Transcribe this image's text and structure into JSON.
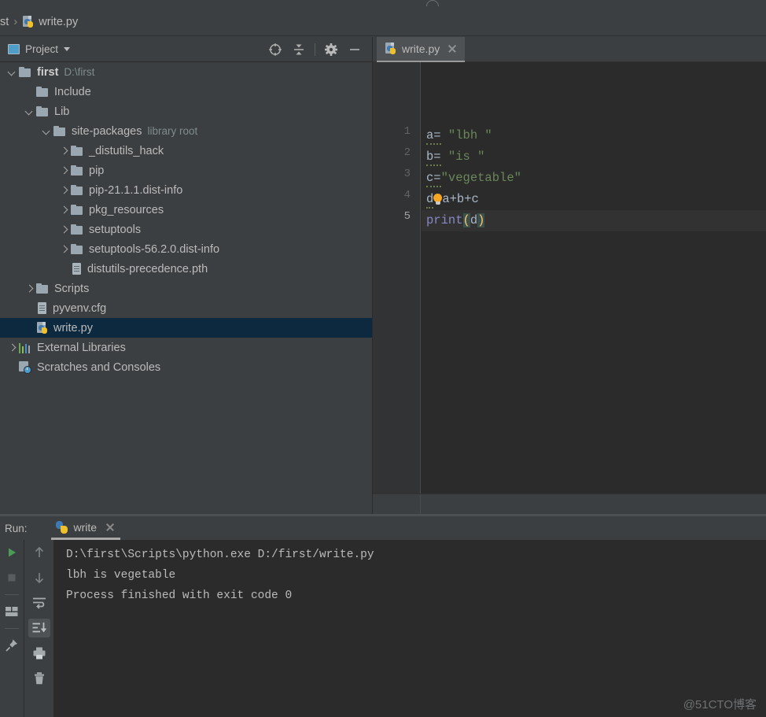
{
  "breadcrumb": {
    "truncated_root": "st",
    "separator": "›",
    "file": "write.py",
    "file_icon": "python-file-icon"
  },
  "project_panel": {
    "title": "Project",
    "title_icon": "project-window-icon",
    "dropdown_icon": "chevron-down-icon",
    "toolbar": [
      {
        "name": "select-opened-file-icon",
        "glyph": "crosshair-target"
      },
      {
        "name": "collapse-all-icon",
        "glyph": "collapse-arrows"
      },
      {
        "name": "settings-gear-icon",
        "glyph": "gear"
      },
      {
        "name": "hide-panel-icon",
        "glyph": "minus"
      }
    ],
    "tree": [
      {
        "label": "first",
        "detail": "D:\\first",
        "icon": "folder-icon",
        "arrow": "down",
        "indent": 0,
        "bold": true,
        "selected": false
      },
      {
        "label": "Include",
        "detail": "",
        "icon": "folder-icon",
        "arrow": "none",
        "indent": 1,
        "bold": false,
        "selected": false
      },
      {
        "label": "Lib",
        "detail": "",
        "icon": "folder-icon",
        "arrow": "down",
        "indent": 1,
        "bold": false,
        "selected": false
      },
      {
        "label": "site-packages",
        "detail": "library root",
        "icon": "folder-icon",
        "arrow": "down",
        "indent": 2,
        "bold": false,
        "selected": false
      },
      {
        "label": "_distutils_hack",
        "detail": "",
        "icon": "folder-icon",
        "arrow": "right",
        "indent": 3,
        "bold": false,
        "selected": false
      },
      {
        "label": "pip",
        "detail": "",
        "icon": "folder-icon",
        "arrow": "right",
        "indent": 3,
        "bold": false,
        "selected": false
      },
      {
        "label": "pip-21.1.1.dist-info",
        "detail": "",
        "icon": "folder-icon",
        "arrow": "right",
        "indent": 3,
        "bold": false,
        "selected": false
      },
      {
        "label": "pkg_resources",
        "detail": "",
        "icon": "folder-icon",
        "arrow": "right",
        "indent": 3,
        "bold": false,
        "selected": false
      },
      {
        "label": "setuptools",
        "detail": "",
        "icon": "folder-icon",
        "arrow": "right",
        "indent": 3,
        "bold": false,
        "selected": false
      },
      {
        "label": "setuptools-56.2.0.dist-info",
        "detail": "",
        "icon": "folder-icon",
        "arrow": "right",
        "indent": 3,
        "bold": false,
        "selected": false
      },
      {
        "label": "distutils-precedence.pth",
        "detail": "",
        "icon": "config-file-icon",
        "arrow": "none",
        "indent": 3,
        "bold": false,
        "selected": false
      },
      {
        "label": "Scripts",
        "detail": "",
        "icon": "folder-icon",
        "arrow": "right",
        "indent": 1,
        "bold": false,
        "selected": false
      },
      {
        "label": "pyvenv.cfg",
        "detail": "",
        "icon": "config-file-icon",
        "arrow": "none",
        "indent": 1,
        "bold": false,
        "selected": false
      },
      {
        "label": "write.py",
        "detail": "",
        "icon": "python-file-icon",
        "arrow": "none",
        "indent": 1,
        "bold": false,
        "selected": true
      },
      {
        "label": "External Libraries",
        "detail": "",
        "icon": "libraries-icon",
        "arrow": "right",
        "indent": 0,
        "bold": false,
        "selected": false
      },
      {
        "label": "Scratches and Consoles",
        "detail": "",
        "icon": "scratches-icon",
        "arrow": "none",
        "indent": 0,
        "bold": false,
        "selected": false
      }
    ]
  },
  "editor": {
    "tab": {
      "label": "write.py",
      "icon": "python-file-icon",
      "close_icon": "close-icon"
    },
    "current_line": 5,
    "lines": [
      {
        "n": "1",
        "text": "a= \"lbh \""
      },
      {
        "n": "2",
        "text": "b= \"is \""
      },
      {
        "n": "3",
        "text": "c=\"vegetable\""
      },
      {
        "n": "4",
        "text": "d=a+b+c"
      },
      {
        "n": "5",
        "text": "print(d)"
      }
    ],
    "inspection_icon": "lightbulb-icon",
    "colors": {
      "background": "#2b2b2b",
      "gutter": "#313335",
      "identifier": "#a9b7c6",
      "string": "#6a8759",
      "function": "#8888c6",
      "bracket_match": "#ffc66d",
      "current_line": "#323232"
    }
  },
  "run_panel": {
    "label": "Run:",
    "tab": {
      "label": "write",
      "icon": "python-icon",
      "close_icon": "close-icon"
    },
    "toolbar_left": [
      {
        "name": "rerun-button-icon",
        "glyph": "play-triangle",
        "state": "enabled"
      },
      {
        "name": "stop-button-icon",
        "glyph": "square",
        "state": "disabled"
      },
      {
        "name": "layout-settings-icon",
        "glyph": "panels",
        "state": "enabled"
      },
      {
        "name": "pin-tab-icon",
        "glyph": "pin",
        "state": "enabled"
      }
    ],
    "toolbar_right": [
      {
        "name": "previous-occurrence-icon",
        "glyph": "arrow-up",
        "state": "disabled"
      },
      {
        "name": "next-occurrence-icon",
        "glyph": "arrow-down",
        "state": "disabled"
      },
      {
        "name": "soft-wrap-icon",
        "glyph": "wrap-lines",
        "state": "enabled"
      },
      {
        "name": "scroll-to-end-icon",
        "glyph": "scroll-end",
        "state": "active"
      },
      {
        "name": "print-icon",
        "glyph": "printer",
        "state": "enabled"
      },
      {
        "name": "clear-all-icon",
        "glyph": "trash",
        "state": "enabled"
      }
    ],
    "console_output": [
      "D:\\first\\Scripts\\python.exe D:/first/write.py",
      "lbh is vegetable",
      "",
      "Process finished with exit code 0"
    ]
  },
  "watermark": "@51CTO博客"
}
